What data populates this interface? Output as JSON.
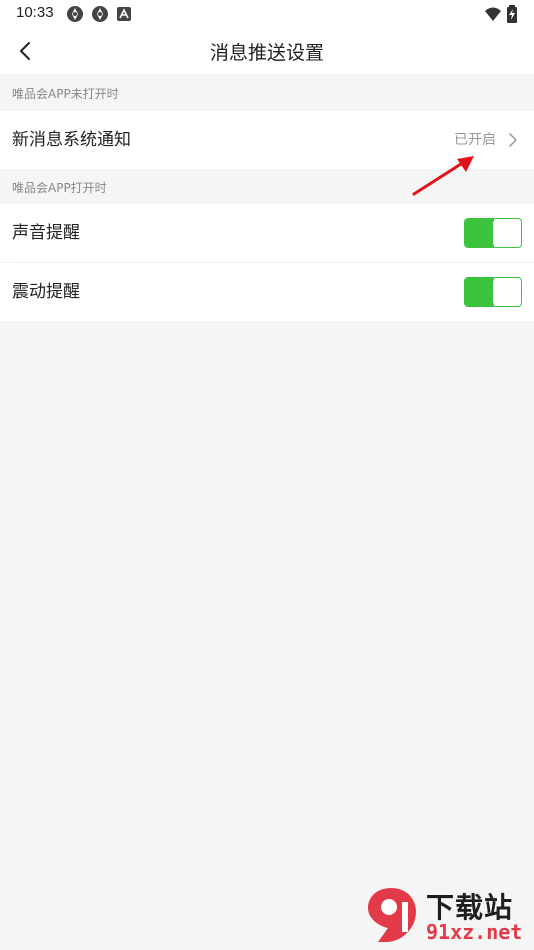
{
  "status_bar": {
    "time": "10:33",
    "icons": [
      "sync-icon",
      "sync-icon",
      "a-icon",
      "wifi-icon",
      "battery-charging-icon"
    ]
  },
  "nav": {
    "back_icon": "chevron-left-icon",
    "title": "消息推送设置"
  },
  "sections": [
    {
      "header": "唯品会APP未打开时",
      "rows": [
        {
          "label": "新消息系统通知",
          "status": "已开启",
          "control": "chevron-right-icon"
        }
      ]
    },
    {
      "header": "唯品会APP打开时",
      "rows": [
        {
          "label": "声音提醒",
          "toggle_on": true
        },
        {
          "label": "震动提醒",
          "toggle_on": true
        }
      ]
    }
  ],
  "colors": {
    "toggle_on": "#3cc43f",
    "background": "#f5f5f5",
    "annotation_arrow": "#e0121c"
  },
  "watermark": {
    "brand": "下载站",
    "logo_text": "91",
    "domain": "91xz.net"
  }
}
